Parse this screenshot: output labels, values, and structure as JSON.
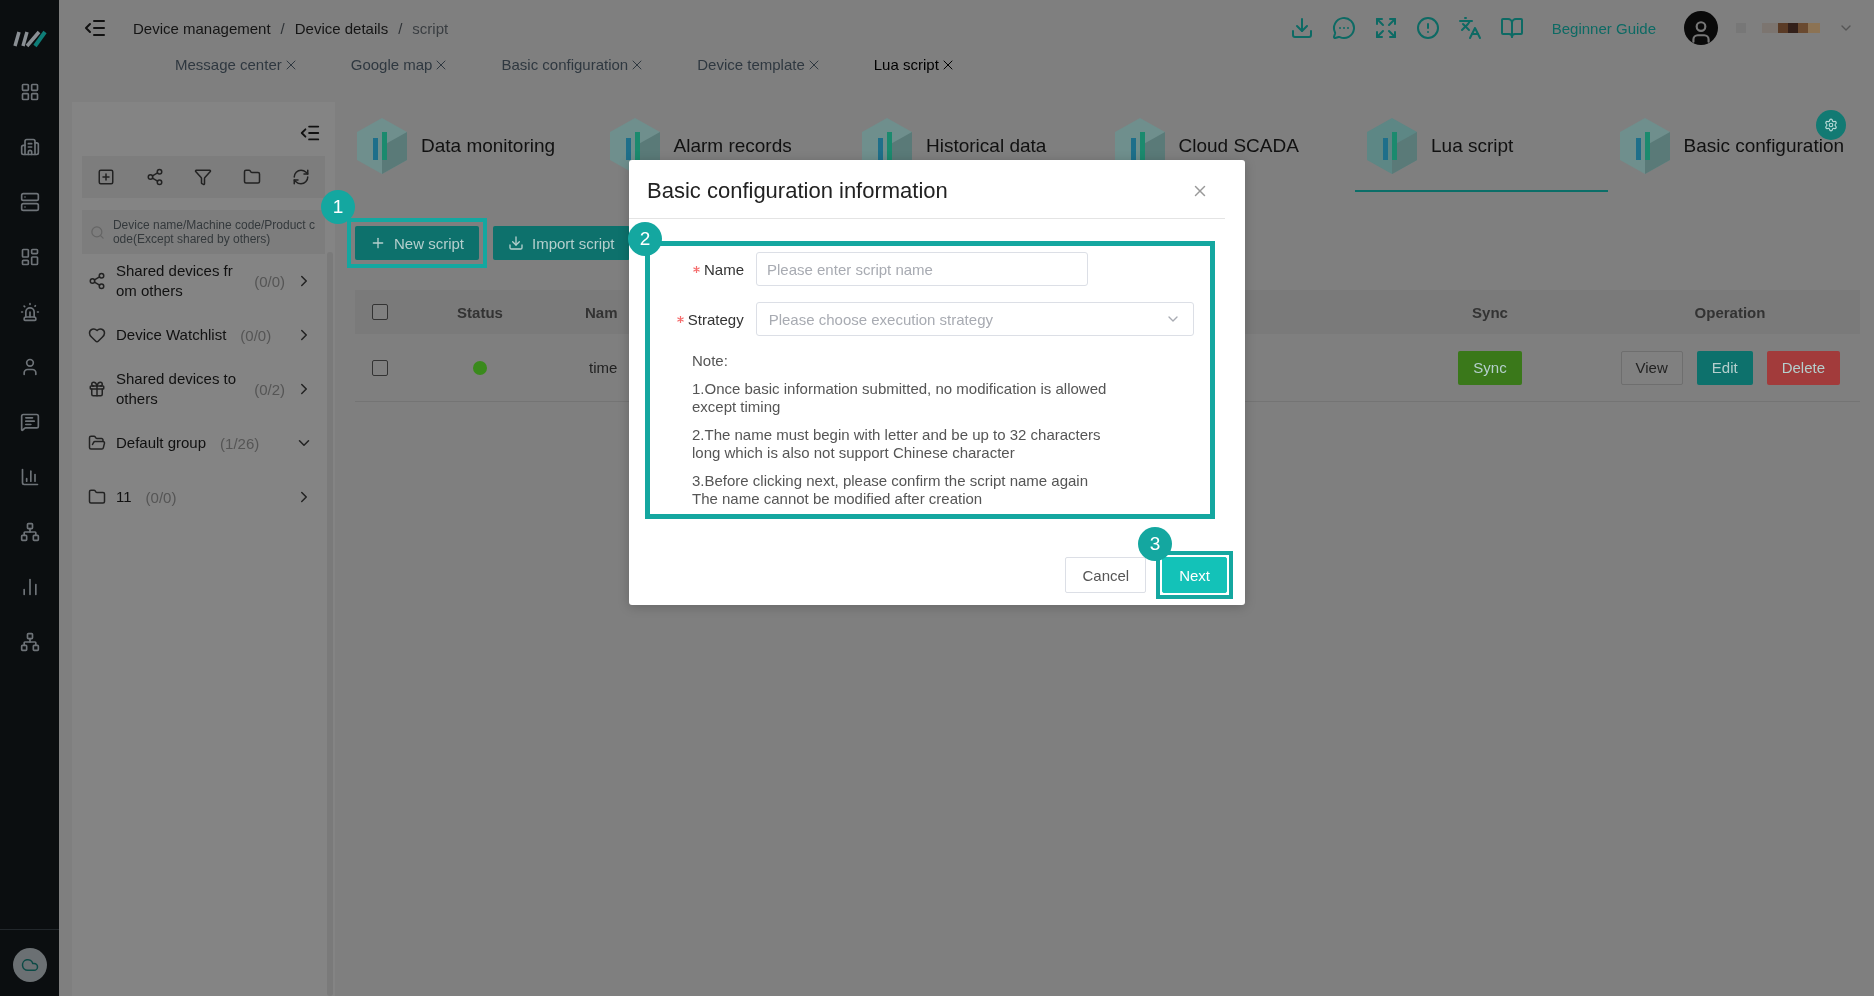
{
  "header": {
    "separator": "/",
    "breadcrumb": [
      {
        "label": "Device management",
        "current": false
      },
      {
        "label": "Device details",
        "current": false
      },
      {
        "label": "script",
        "current": true
      }
    ],
    "page_tabs": [
      {
        "label": "Message center",
        "selected": false
      },
      {
        "label": "Google map",
        "selected": false
      },
      {
        "label": "Basic configuration",
        "selected": false
      },
      {
        "label": "Device template",
        "selected": false
      },
      {
        "label": "Lua script",
        "selected": true
      }
    ],
    "guide_link": "Beginner Guide"
  },
  "sidebar": {
    "search": {
      "placeholder": "Device name/Machine code/Product code(Except shared by others)"
    },
    "items": [
      {
        "kind": "share",
        "label": "Shared devices from others",
        "count": "(0/0)",
        "expanded": false
      },
      {
        "kind": "heart",
        "label": "Device Watchlist",
        "count": "(0/0)",
        "expanded": false
      },
      {
        "kind": "gift",
        "label": "Shared devices to others",
        "count": "(0/2)",
        "expanded": false
      },
      {
        "kind": "folder-open",
        "label": "Default group",
        "count": "(1/26)",
        "expanded": true
      },
      {
        "kind": "folder",
        "label": "11",
        "count": "(0/0)",
        "expanded": false
      }
    ]
  },
  "feature_tabs": [
    {
      "label": "Data monitoring",
      "selected": false
    },
    {
      "label": "Alarm records",
      "selected": false
    },
    {
      "label": "Historical data",
      "selected": false
    },
    {
      "label": "Cloud SCADA",
      "selected": false
    },
    {
      "label": "Lua script",
      "selected": true
    },
    {
      "label": "Basic configuration",
      "selected": false
    }
  ],
  "actions": [
    {
      "label": "New script",
      "kind": "new",
      "step": "1"
    },
    {
      "label": "Import script",
      "kind": "import"
    }
  ],
  "table": {
    "header_checked": false,
    "columns": [
      "Status",
      "Nam",
      "Sync",
      "Operation"
    ],
    "rows": [
      {
        "checked": false,
        "active": true,
        "name": "time",
        "sync": "Sync",
        "actions": [
          "View",
          "Edit",
          "Delete"
        ]
      }
    ]
  },
  "modal": {
    "title": "Basic configuration information",
    "step": "2",
    "fields": [
      {
        "kind": "input",
        "label": "Name",
        "required": true,
        "placeholder": "Please enter script name"
      },
      {
        "kind": "select",
        "label": "Strategy",
        "required": true,
        "placeholder": "Please choose execution strategy"
      }
    ],
    "note_title": "Note:",
    "notes": [
      {
        "lines": [
          "1.Once basic information submitted, no modification is allowed",
          "except timing"
        ]
      },
      {
        "lines": [
          "2.The name must begin with letter and be up to 32 characters",
          "long which is also not support Chinese character"
        ]
      },
      {
        "lines": [
          "3.Before clicking next, please confirm the script name again",
          "The name cannot be modified after creation"
        ]
      }
    ],
    "buttons": [
      {
        "label": "Cancel",
        "primary": false
      },
      {
        "label": "Next",
        "primary": true,
        "step": "3"
      }
    ]
  }
}
